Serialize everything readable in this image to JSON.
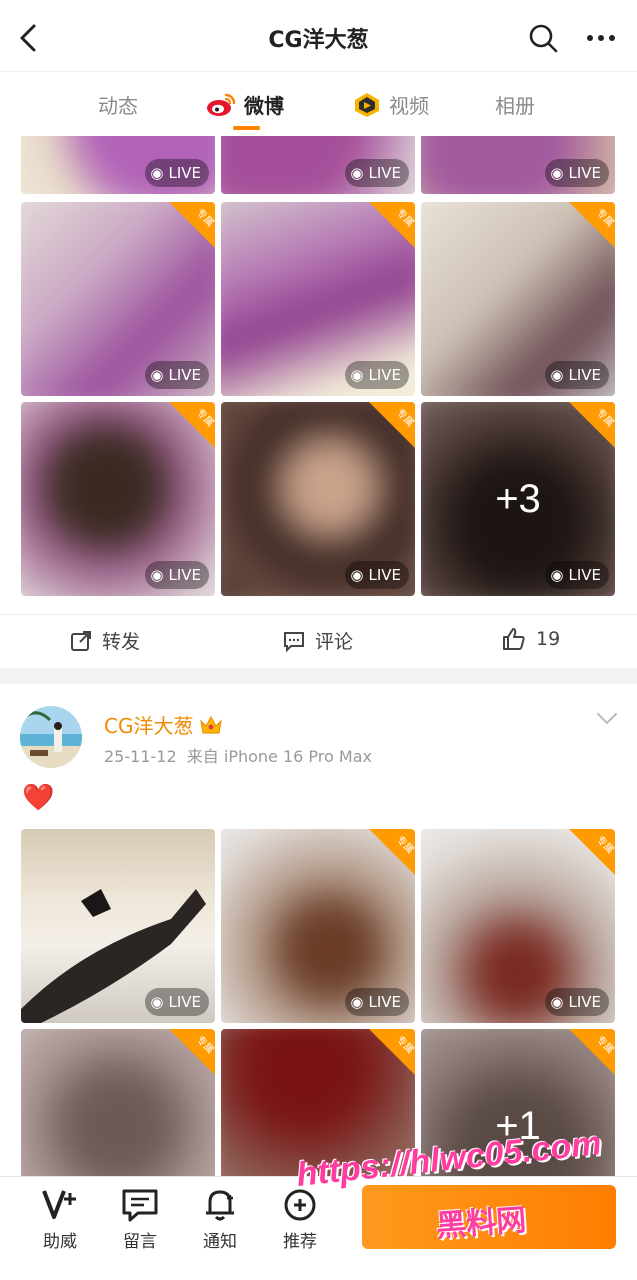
{
  "header": {
    "title": "CG洋大葱",
    "back_icon": "back-arrow-icon",
    "search_icon": "search-icon",
    "more_icon": "more-dots-icon"
  },
  "tabs": [
    {
      "label": "动态",
      "active": false
    },
    {
      "label": "微博",
      "active": true,
      "icon": "weibo-logo-icon"
    },
    {
      "label": "视频",
      "active": false,
      "icon": "video-badge-icon"
    },
    {
      "label": "相册",
      "active": false
    }
  ],
  "post1": {
    "live_label": "LIVE",
    "more_count": "+3",
    "actions": {
      "repost": "转发",
      "comment": "评论",
      "like_count": "19"
    }
  },
  "post2": {
    "username": "CG洋大葱",
    "crown_icon": "crown-icon",
    "date": "25-11-12",
    "source": "来自 iPhone 16 Pro Max",
    "content_emoji": "❤️",
    "live_label": "LIVE",
    "more_count": "+1"
  },
  "bottom_nav": [
    {
      "label": "助威",
      "icon": "cheer-v-icon"
    },
    {
      "label": "留言",
      "icon": "message-icon"
    },
    {
      "label": "通知",
      "icon": "bell-icon"
    },
    {
      "label": "推荐",
      "icon": "recommend-icon"
    }
  ],
  "watermark": {
    "url": "https://hlwc05.com",
    "name": "黑料网"
  },
  "vip_badge_text": "专属",
  "colors": {
    "accent": "#ff8200",
    "username": "#f28a00"
  }
}
